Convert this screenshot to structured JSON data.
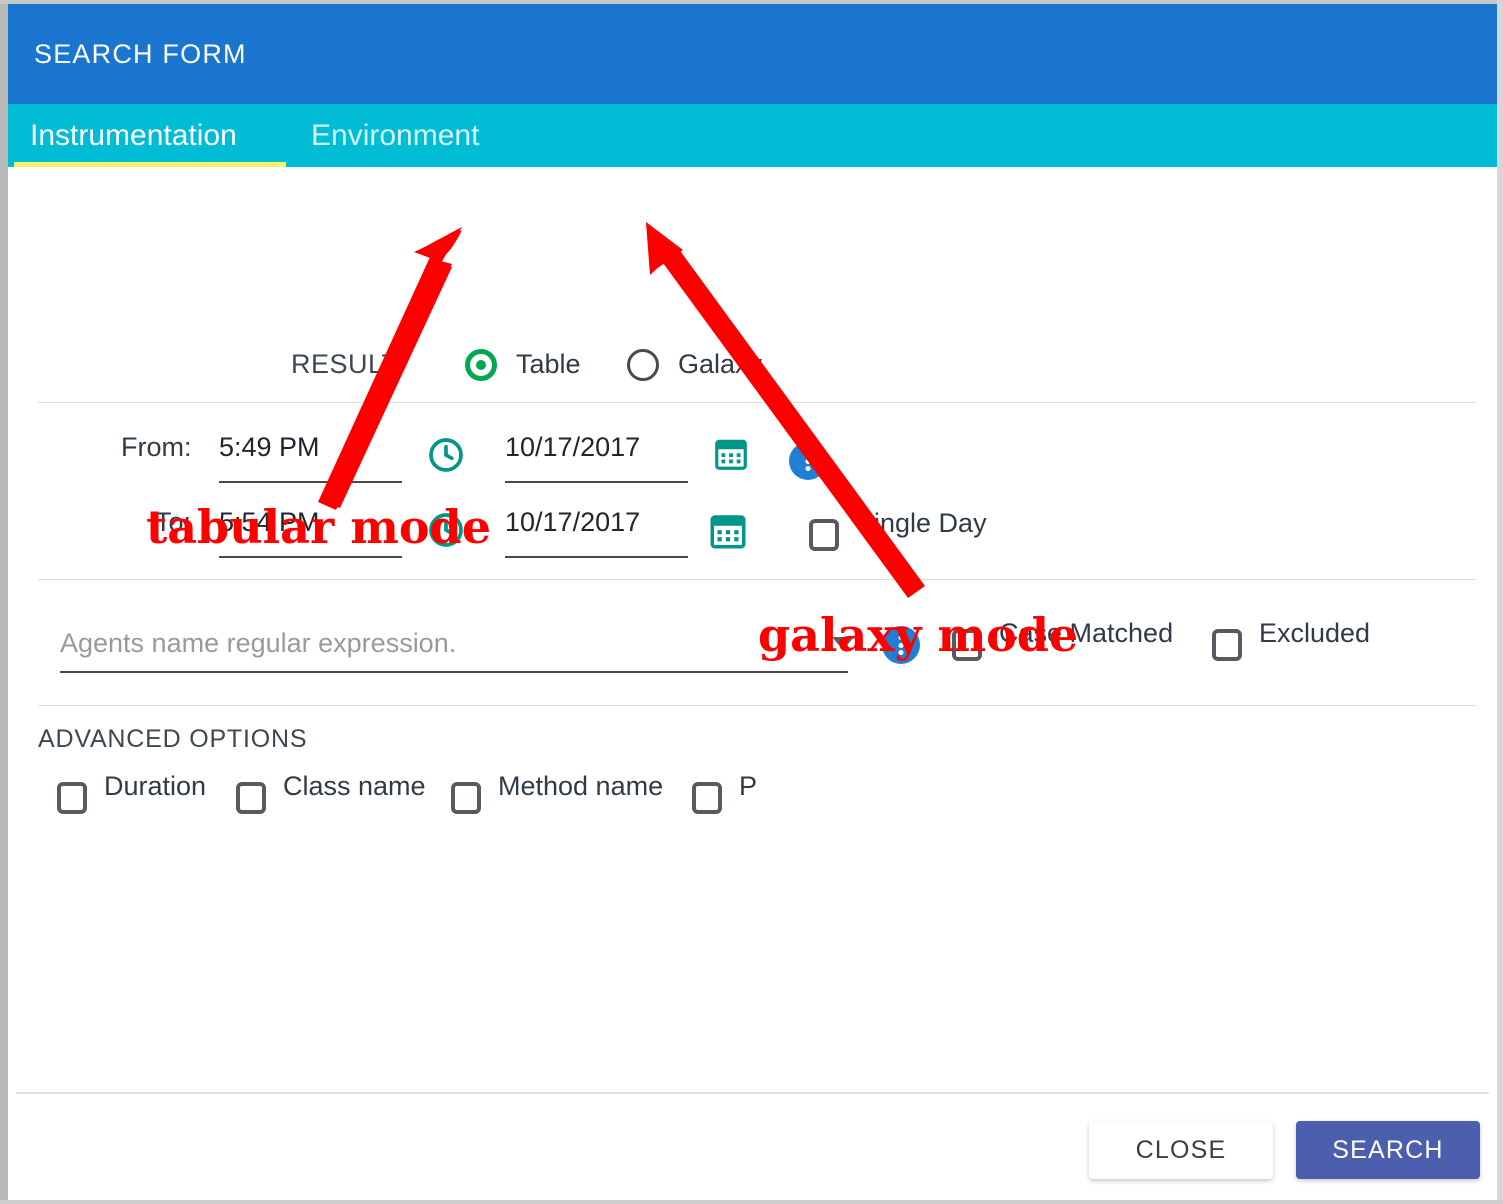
{
  "window": {
    "title": "SEARCH FORM"
  },
  "tabs": [
    {
      "label": "Instrumentation",
      "active": true
    },
    {
      "label": "Environment",
      "active": false
    }
  ],
  "result_row": {
    "label": "RESULT",
    "options": [
      {
        "label": "Table",
        "selected": true
      },
      {
        "label": "Galaxy",
        "selected": false
      }
    ]
  },
  "date_range": {
    "from": {
      "label": "From:",
      "time": "5:49 PM",
      "date": "10/17/2017",
      "clock_icon": "clock-icon",
      "calendar_icon": "calendar-icon",
      "menu_icon": "vertical-dots-icon"
    },
    "to": {
      "label": "To:",
      "time": "5:54 PM",
      "date": "10/17/2017",
      "clock_icon": "clock-icon",
      "calendar_icon": "calendar-icon"
    },
    "single_day": {
      "label": "Single Day",
      "checked": false
    }
  },
  "agents": {
    "placeholder": "Agents name regular expression.",
    "value": "",
    "dropdown_icon": "chevron-down-icon",
    "menu_icon": "vertical-dots-icon",
    "options": [
      {
        "label": "Case Matched",
        "checked": false
      },
      {
        "label": "Excluded",
        "checked": false
      }
    ]
  },
  "advanced_options": {
    "title": "ADVANCED OPTIONS",
    "items": [
      {
        "label": "Duration",
        "checked": false
      },
      {
        "label": "Class name",
        "checked": false
      },
      {
        "label": "Method name",
        "checked": false
      },
      {
        "label": "P",
        "checked": false
      }
    ]
  },
  "footer": {
    "close_label": "CLOSE",
    "search_label": "SEARCH"
  },
  "annotations": [
    {
      "text": "tabular mode",
      "points_to": "Table radio button"
    },
    {
      "text": "galaxy mode",
      "points_to": "Galaxy radio button"
    }
  ],
  "colors": {
    "header_blue": "#1a75cf",
    "tabbar_cyan": "#00bcd4",
    "tab_underline_yellow": "#fbf06b",
    "radio_green": "#00a84f",
    "icon_teal": "#009688",
    "dots_blue": "#1f7fd4",
    "search_button": "#4c5fae",
    "annotation_red": "#ff0000"
  }
}
